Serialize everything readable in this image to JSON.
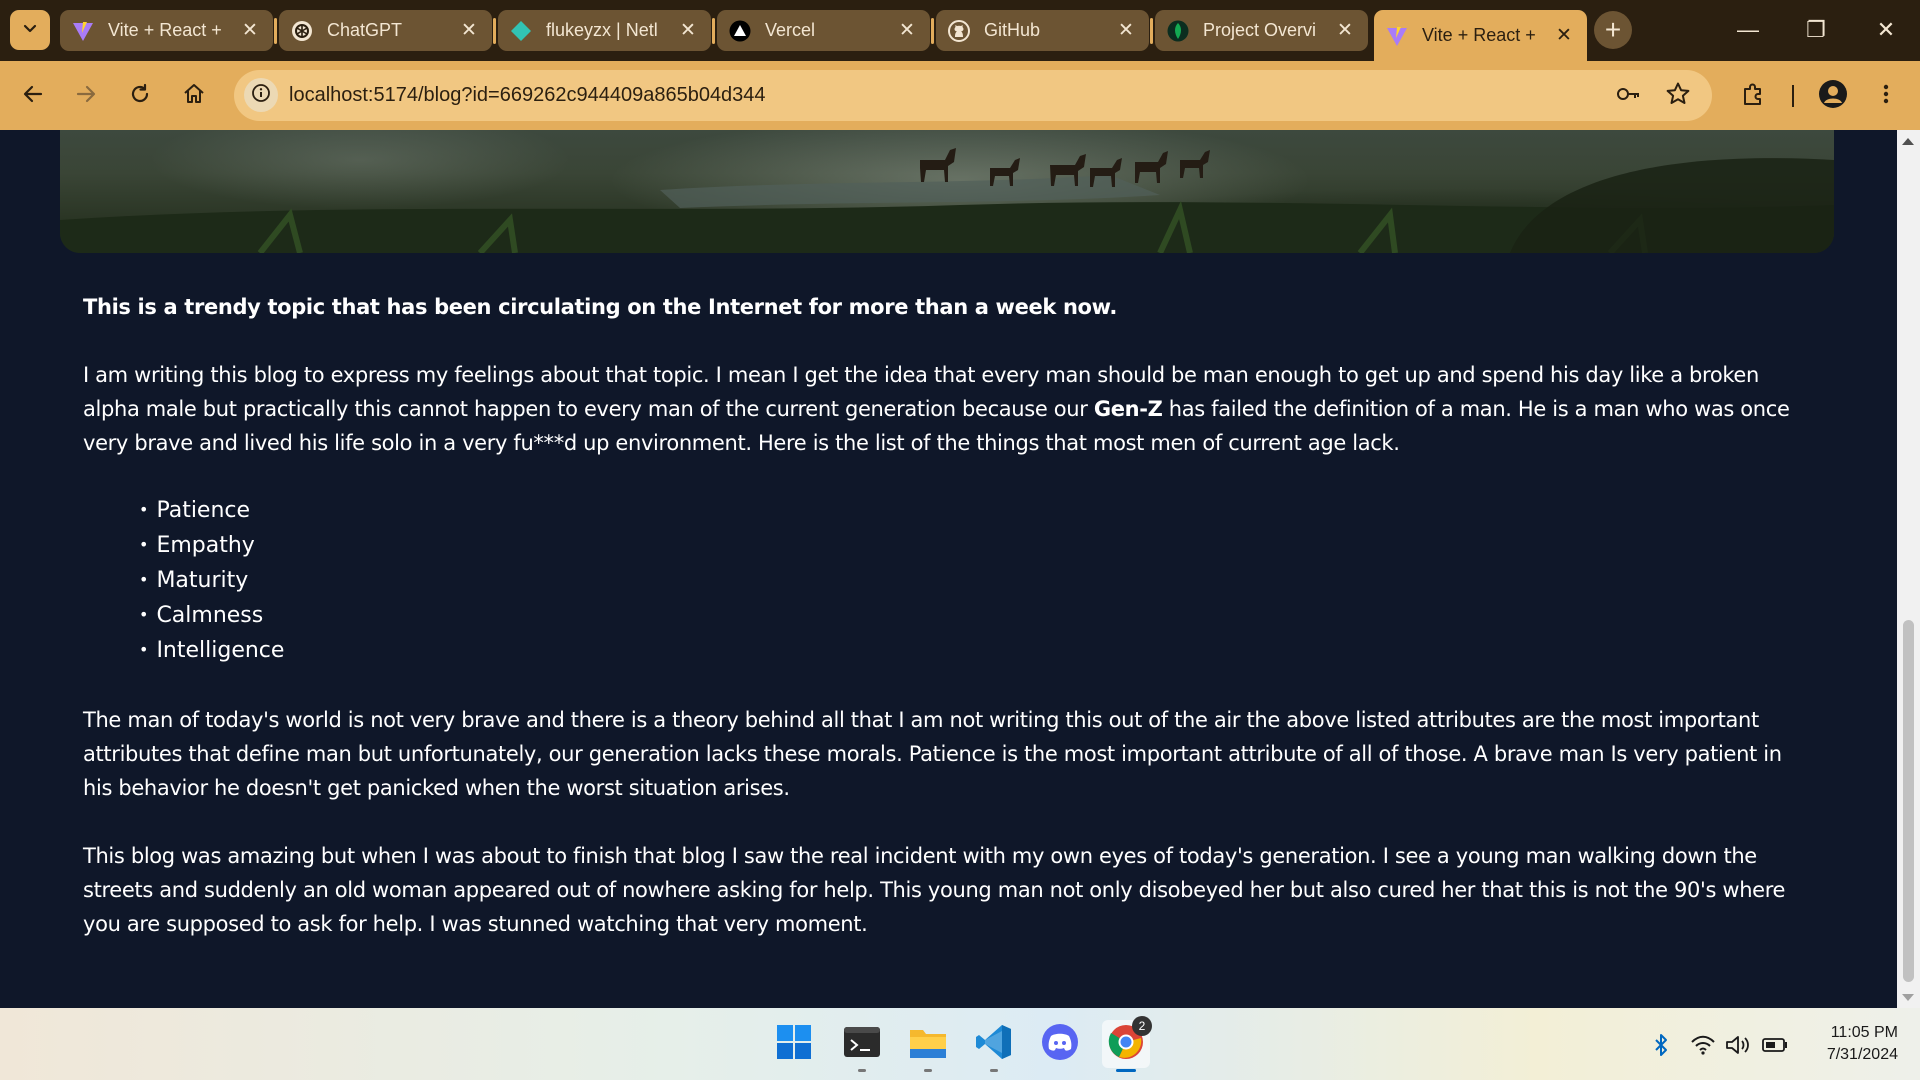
{
  "browser": {
    "tabs": [
      {
        "title": "Vite + React +",
        "favicon": "vite-icon",
        "active": false
      },
      {
        "title": "ChatGPT",
        "favicon": "chatgpt-icon",
        "active": false
      },
      {
        "title": "flukeyzx | Netl",
        "favicon": "netlify-icon",
        "active": false
      },
      {
        "title": "Vercel",
        "favicon": "vercel-icon",
        "active": false
      },
      {
        "title": "GitHub",
        "favicon": "github-icon",
        "active": false
      },
      {
        "title": "Project Overvi",
        "favicon": "mongodb-icon",
        "active": false
      },
      {
        "title": "Vite + React +",
        "favicon": "vite-icon",
        "active": true
      }
    ],
    "close_glyph": "✕",
    "new_tab_glyph": "+",
    "window": {
      "minimize": "—",
      "restore": "❐",
      "close": "✕"
    },
    "url": "localhost:5174/blog?id=669262c944409a865b04d344"
  },
  "article": {
    "lead": "This is a trendy topic that has been circulating on the Internet for more than a week now.",
    "para1_before": "I am writing this blog to express my feelings about that topic. I mean I get the idea that every man should be man enough to get up and spend his day like a broken alpha male but practically this cannot happen to every man of the current generation because our ",
    "para1_bold": "Gen-Z",
    "para1_after": " has failed the definition of a man. He is a man who was once very brave and lived his life solo in a very fu***d up environment. Here is the list of the things that most men of current age lack.",
    "bullets": [
      "Patience",
      "Empathy",
      "Maturity",
      "Calmness",
      "Intelligence"
    ],
    "para2": "The man of today's world is not very brave and there is a theory behind all that I am not writing this out of the air the above listed attributes are the most important attributes that define man but unfortunately, our generation lacks these morals. Patience is the most important attribute of all of those. A brave man Is very patient in his behavior he doesn't get panicked when the worst situation arises.",
    "para3": "This blog was amazing but when I was about to finish that blog I saw the real incident with my own eyes of today's generation. I see a young man walking down the streets and suddenly an old woman appeared out of nowhere asking for help. This young man not only disobeyed her but also cured her that this is not the 90's where you are supposed to ask for help. I was stunned watching that very moment."
  },
  "taskbar": {
    "apps": [
      "windows-start-icon",
      "terminal-icon",
      "file-explorer-icon",
      "vscode-icon",
      "discord-icon",
      "chrome-icon"
    ],
    "chrome_badge": "2",
    "time": "11:05 PM",
    "date": "7/31/2024"
  },
  "colors": {
    "tab_strip": "#2b1f10",
    "toolbar": "#e3ad5c",
    "page_bg": "#0f1729",
    "text": "#ffffff"
  }
}
